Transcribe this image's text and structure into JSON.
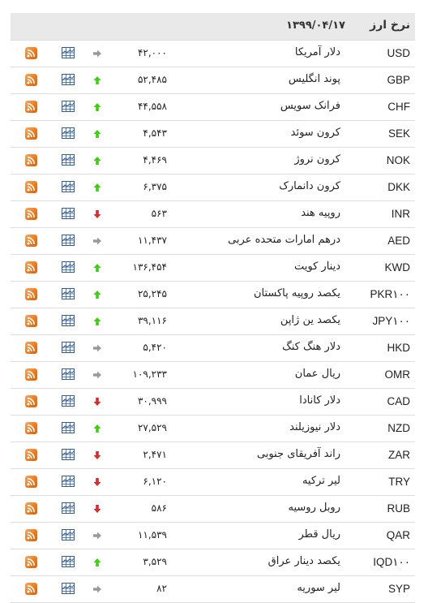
{
  "header": {
    "title": "نرخ ارز",
    "date": "۱۳۹۹/۰۴/۱۷"
  },
  "colors": {
    "up": "#3ecf0f",
    "down": "#d62c2c",
    "same": "#9a9a9a",
    "rss": "#ef7a1a",
    "chart": "#2e5e9e"
  },
  "rows": [
    {
      "code": "USD",
      "name": "دلار آمریکا",
      "value": "۴۲,۰۰۰",
      "trend": "same"
    },
    {
      "code": "GBP",
      "name": "پوند انگلیس",
      "value": "۵۲,۴۸۵",
      "trend": "up"
    },
    {
      "code": "CHF",
      "name": "فرانک سویس",
      "value": "۴۴,۵۵۸",
      "trend": "up"
    },
    {
      "code": "SEK",
      "name": "کرون سوئد",
      "value": "۴,۵۴۳",
      "trend": "up"
    },
    {
      "code": "NOK",
      "name": "کرون نروژ",
      "value": "۴,۴۶۹",
      "trend": "up"
    },
    {
      "code": "DKK",
      "name": "کرون دانمارک",
      "value": "۶,۳۷۵",
      "trend": "up"
    },
    {
      "code": "INR",
      "name": "روپیه هند",
      "value": "۵۶۳",
      "trend": "down"
    },
    {
      "code": "AED",
      "name": "درهم امارات متحده عربی",
      "value": "۱۱,۴۳۷",
      "trend": "same"
    },
    {
      "code": "KWD",
      "name": "دینار کویت",
      "value": "۱۳۶,۴۵۴",
      "trend": "up"
    },
    {
      "code": "PKR۱۰۰",
      "name": "یکصد روپیه پاکستان",
      "value": "۲۵,۲۴۵",
      "trend": "up"
    },
    {
      "code": "JPY۱۰۰",
      "name": "یکصد ین ژاپن",
      "value": "۳۹,۱۱۶",
      "trend": "up"
    },
    {
      "code": "HKD",
      "name": "دلار هنگ کنگ",
      "value": "۵,۴۲۰",
      "trend": "same"
    },
    {
      "code": "OMR",
      "name": "ریال عمان",
      "value": "۱۰۹,۲۳۳",
      "trend": "same"
    },
    {
      "code": "CAD",
      "name": "دلار کانادا",
      "value": "۳۰,۹۹۹",
      "trend": "down"
    },
    {
      "code": "NZD",
      "name": "دلار نیوزیلند",
      "value": "۲۷,۵۲۹",
      "trend": "up"
    },
    {
      "code": "ZAR",
      "name": "راند آفریقای جنوبی",
      "value": "۲,۴۷۱",
      "trend": "down"
    },
    {
      "code": "TRY",
      "name": "لیر ترکیه",
      "value": "۶,۱۲۰",
      "trend": "down"
    },
    {
      "code": "RUB",
      "name": "روبل روسیه",
      "value": "۵۸۶",
      "trend": "down"
    },
    {
      "code": "QAR",
      "name": "ریال قطر",
      "value": "۱۱,۵۳۹",
      "trend": "same"
    },
    {
      "code": "IQD۱۰۰",
      "name": "یکصد دینار عراق",
      "value": "۳,۵۲۹",
      "trend": "up"
    },
    {
      "code": "SYP",
      "name": "لیر سوریه",
      "value": "۸۲",
      "trend": "same"
    }
  ]
}
